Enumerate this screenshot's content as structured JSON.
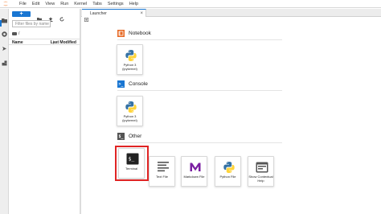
{
  "menubar": {
    "items": [
      "File",
      "Edit",
      "View",
      "Run",
      "Kernel",
      "Tabs",
      "Settings",
      "Help"
    ]
  },
  "activitybar": {
    "icons": [
      "folder-icon",
      "running-icon",
      "commands-icon",
      "extensions-icon"
    ]
  },
  "filebrowser": {
    "new_button": "+",
    "search_placeholder": "Filter files by name",
    "path": "/",
    "columns": {
      "name": "Name",
      "modified": "Last Modified"
    }
  },
  "tab": {
    "label": "Launcher",
    "close": "×"
  },
  "sections": {
    "notebook": "Notebook",
    "console": "Console",
    "other": "Other"
  },
  "cards": {
    "notebook_python3": "Python 3 (ipykernel)",
    "console_python3": "Python 3 (ipykernel)",
    "terminal": "Terminal",
    "text_file": "Text File",
    "markdown_file": "Markdown File",
    "python_file": "Python File",
    "contextual_help": "Show Contextual Help"
  },
  "colors": {
    "accent": "#1976d2",
    "notebook_icon": "#e76a26",
    "console_icon": "#1976d2",
    "other_icon": "#555555",
    "markdown": "#7b1fa2",
    "highlight": "#e02424"
  }
}
